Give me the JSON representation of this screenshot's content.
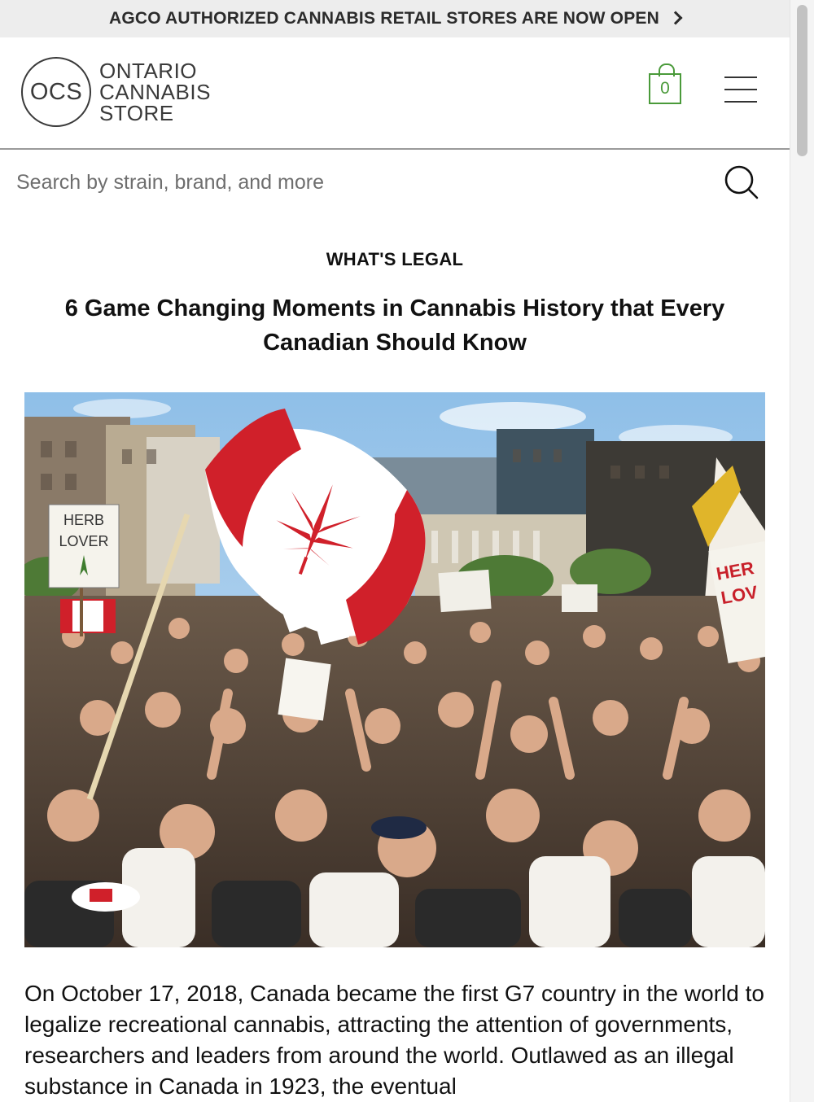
{
  "announcement": {
    "text": "AGCO AUTHORIZED CANNABIS RETAIL STORES ARE NOW OPEN"
  },
  "logo": {
    "mark": "OCS",
    "line1": "ONTARIO",
    "line2": "CANNABIS",
    "line3": "STORE"
  },
  "cart": {
    "count": "0"
  },
  "search": {
    "placeholder": "Search by strain, brand, and more"
  },
  "article": {
    "category": "WHAT'S LEGAL",
    "title": "6 Game Changing Moments in Cannabis History that Every Canadian Should Know",
    "hero_signs": {
      "left": "HERB LOVER",
      "right": "HER LOV"
    },
    "body": "On October 17, 2018, Canada became the first G7 country in the world to legalize recreational cannabis, attracting the attention of governments, researchers and leaders from around the world. Outlawed as an illegal substance in Canada in 1923, the eventual"
  },
  "icons": {
    "announcement": "chevron-right-icon",
    "cart": "shopping-bag-icon",
    "menu": "hamburger-menu-icon",
    "search": "search-icon"
  },
  "colors": {
    "announcement_bg": "#ededed",
    "cart_accent": "#4a9a3a",
    "flag_red": "#d0202a",
    "text": "#111111"
  }
}
